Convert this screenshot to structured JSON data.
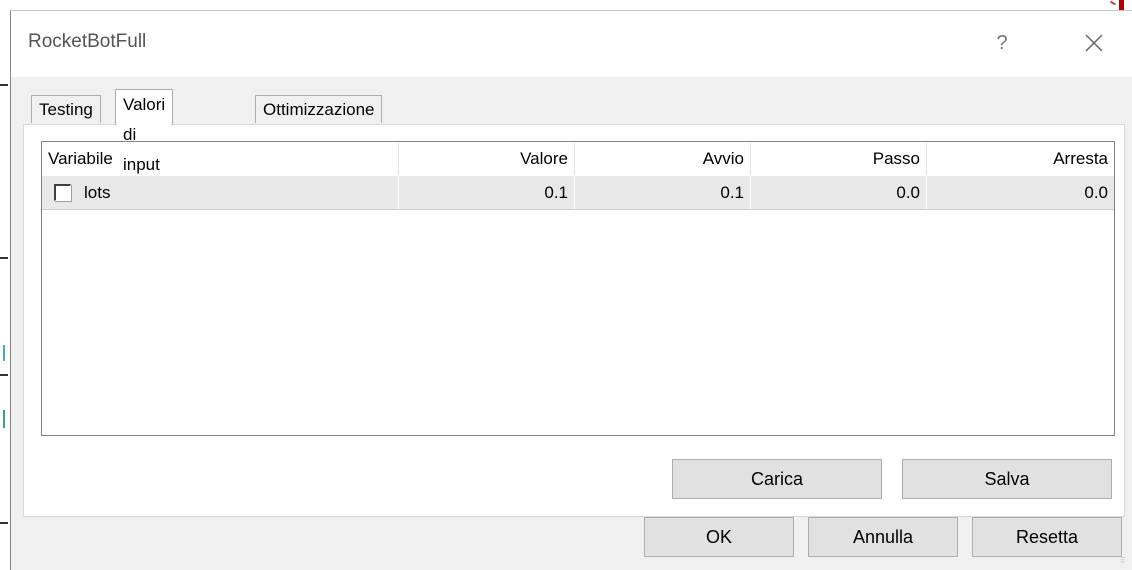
{
  "window": {
    "title": "RocketBotFull",
    "help_glyph": "?"
  },
  "tabs": [
    {
      "label": "Testing",
      "active": false
    },
    {
      "label": "Valori di input",
      "active": true
    },
    {
      "label": "Ottimizzazione",
      "active": false
    }
  ],
  "table": {
    "headers": [
      "Variabile",
      "Valore",
      "Avvio",
      "Passo",
      "Arresta"
    ],
    "rows": [
      {
        "checked": false,
        "name": "lots",
        "valore": "0.1",
        "avvio": "0.1",
        "passo": "0.0",
        "arresta": "0.0"
      }
    ]
  },
  "panel_buttons": {
    "load": "Carica",
    "save": "Salva"
  },
  "footer_buttons": {
    "ok": "OK",
    "cancel": "Annulla",
    "reset": "Resetta"
  },
  "colors": {
    "dialog_bg": "#f0f0f0",
    "row_bg": "#e8e8e8",
    "button_bg": "#e1e1e1"
  }
}
